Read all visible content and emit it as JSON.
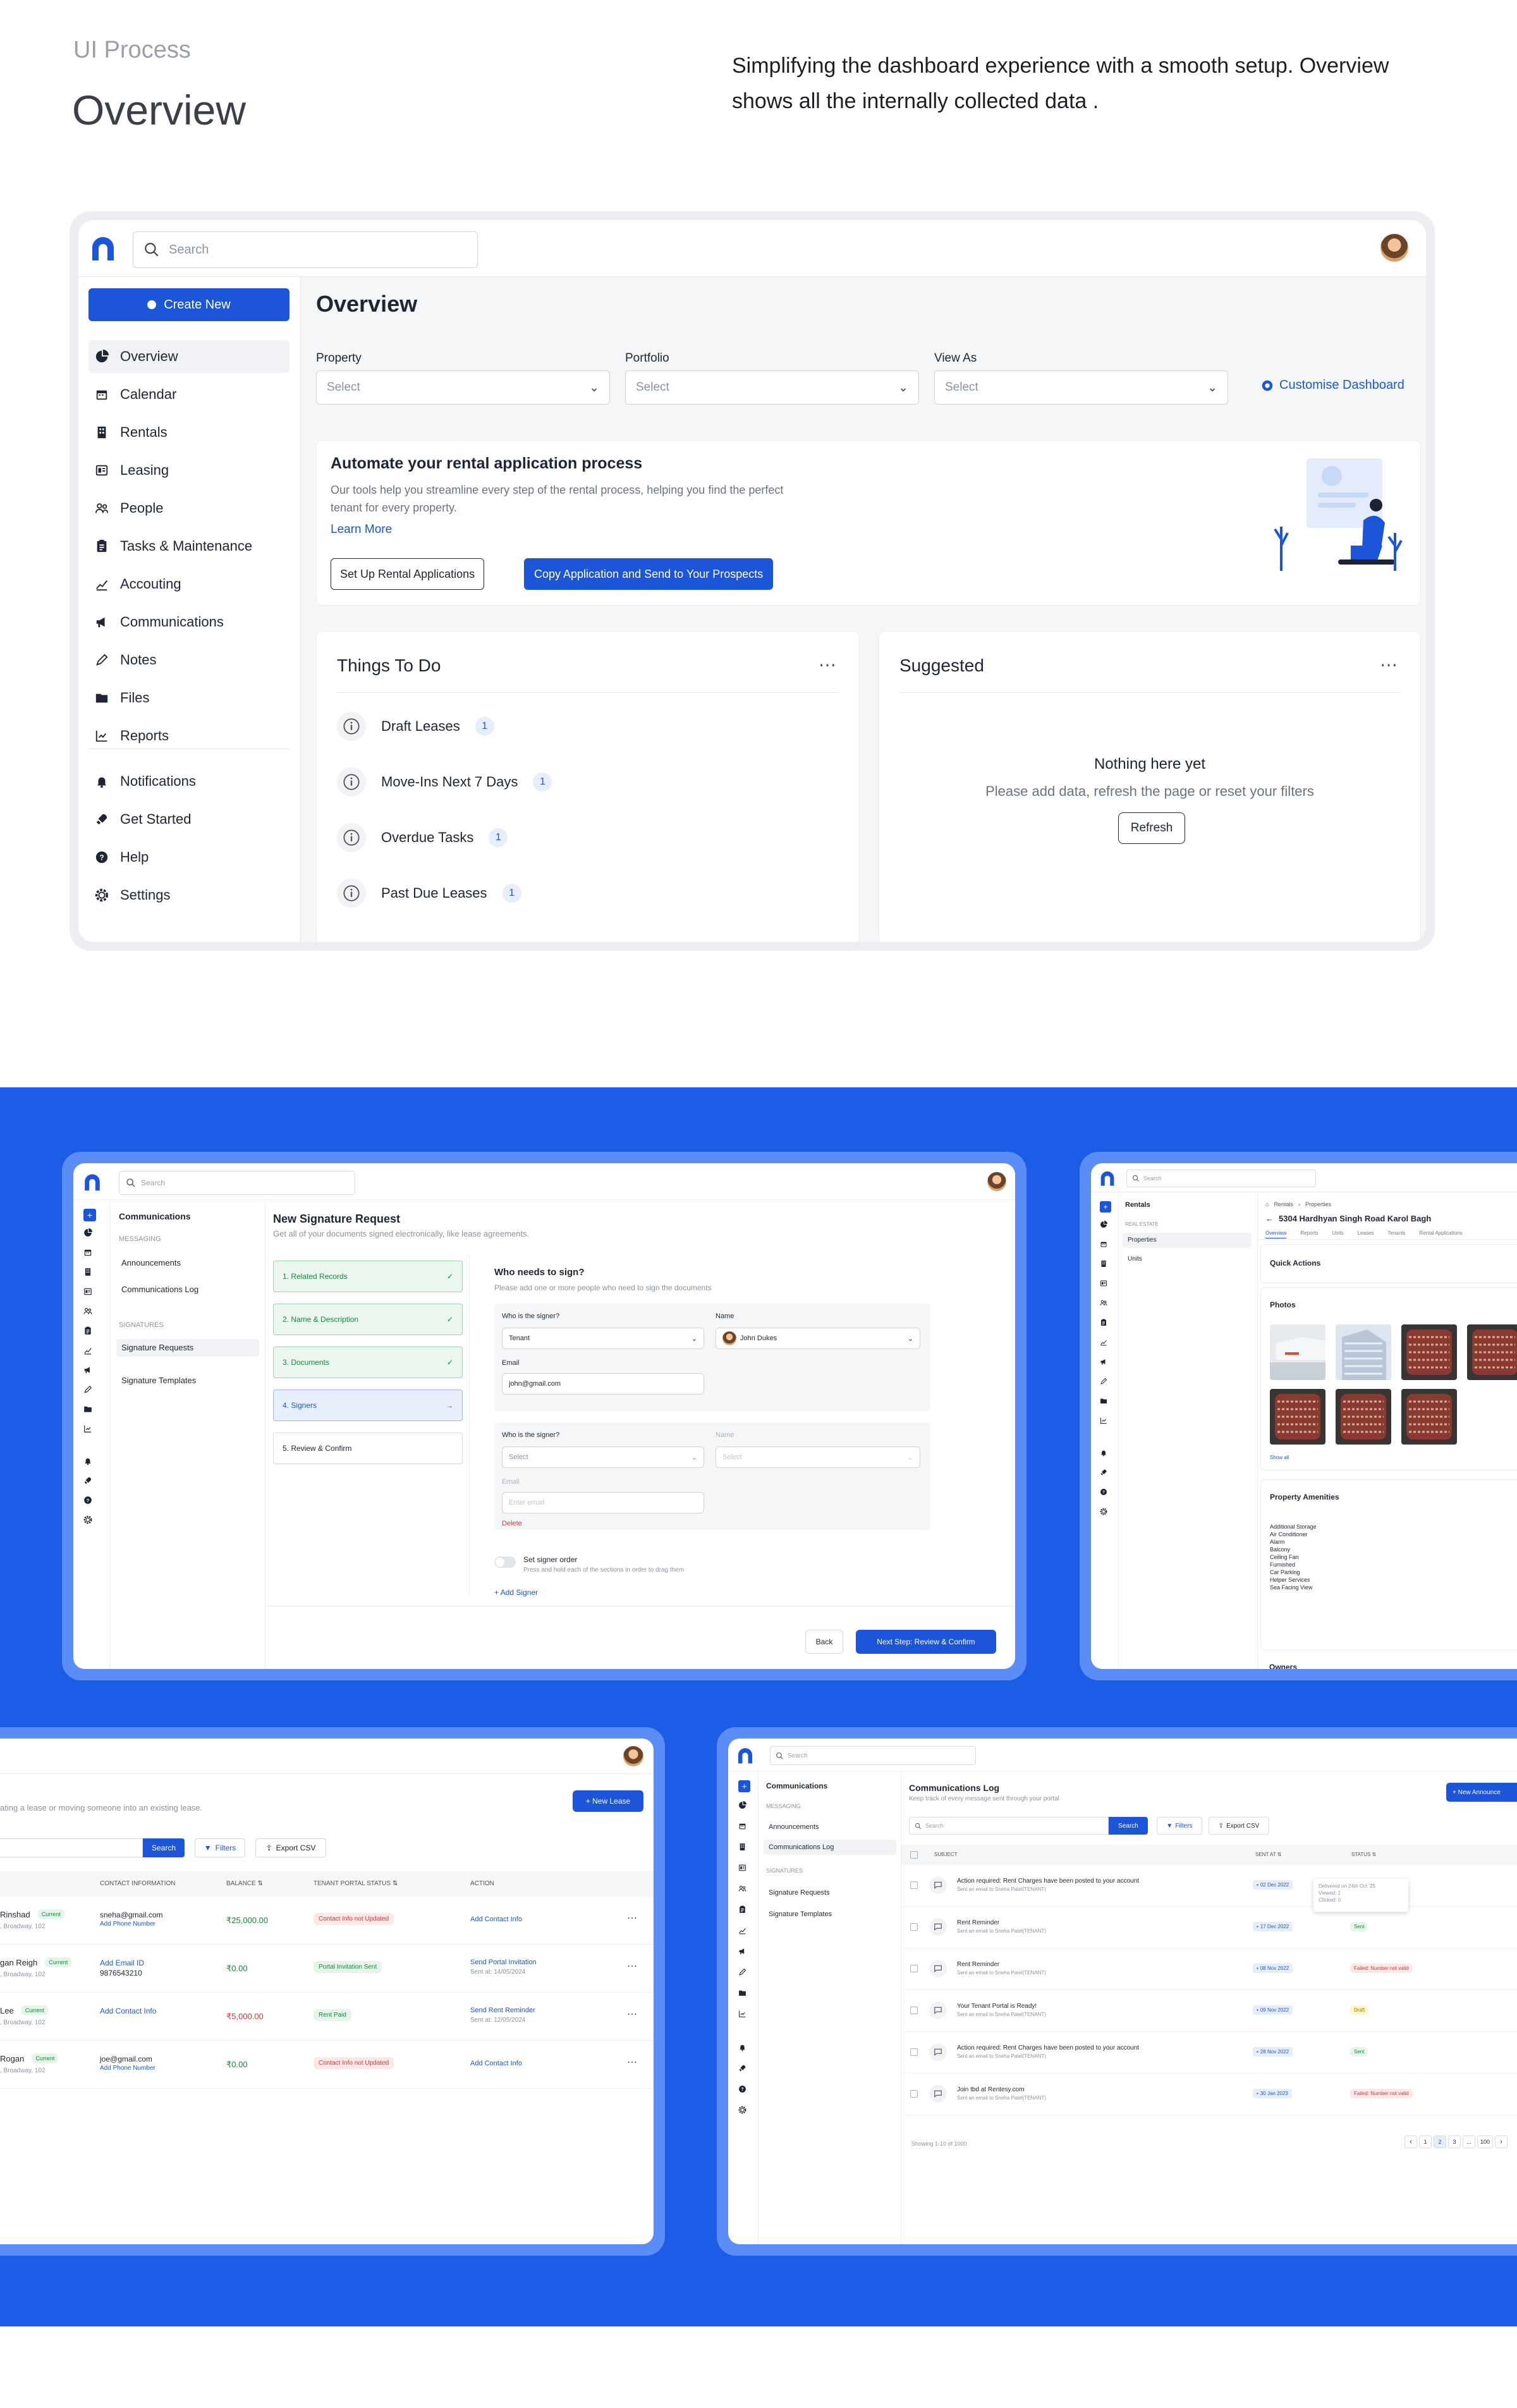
{
  "header": {
    "eyebrow": "UI Process",
    "title": "Overview",
    "description": "Simplifying the dashboard experience with a smooth setup. Overview shows all the internally collected data ."
  },
  "colors": {
    "brand": "#1c55d8",
    "bg_blue": "#1c5ce6",
    "light_blue": "#5b8df7",
    "green": "#148a3a",
    "red": "#d43838"
  },
  "main_mock": {
    "search_placeholder": "Search",
    "create_new": "Create New",
    "nav": [
      {
        "label": "Overview",
        "icon": "pie-chart-icon"
      },
      {
        "label": "Calendar",
        "icon": "calendar-icon"
      },
      {
        "label": "Rentals",
        "icon": "building-icon"
      },
      {
        "label": "Leasing",
        "icon": "lease-icon"
      },
      {
        "label": "People",
        "icon": "people-icon"
      },
      {
        "label": "Tasks & Maintenance",
        "icon": "clipboard-icon"
      },
      {
        "label": "Accouting",
        "icon": "chart-line-icon"
      },
      {
        "label": "Communications",
        "icon": "megaphone-icon"
      },
      {
        "label": "Notes",
        "icon": "pen-icon"
      },
      {
        "label": "Files",
        "icon": "folder-icon"
      },
      {
        "label": "Reports",
        "icon": "report-icon"
      }
    ],
    "nav_bottom": [
      {
        "label": "Notifications",
        "icon": "bell-icon"
      },
      {
        "label": "Get Started",
        "icon": "rocket-icon"
      },
      {
        "label": "Help",
        "icon": "help-icon"
      },
      {
        "label": "Settings",
        "icon": "gear-icon"
      }
    ],
    "page_title": "Overview",
    "filters": [
      {
        "label": "Property",
        "value": "Select"
      },
      {
        "label": "Portfolio",
        "value": "Select"
      },
      {
        "label": "View As",
        "value": "Select"
      }
    ],
    "customise": "Customise Dashboard",
    "banner": {
      "title": "Automate your rental application process",
      "text": "Our tools help you streamline every step of the rental process, helping you find the perfect tenant for every property.",
      "link": "Learn More",
      "btn1": "Set Up Rental Applications",
      "btn2": "Copy Application and Send to Your Prospects"
    },
    "todo": {
      "title": "Things To Do",
      "items": [
        {
          "label": "Draft Leases",
          "count": "1"
        },
        {
          "label": "Move-Ins Next 7 Days",
          "count": "1"
        },
        {
          "label": "Overdue Tasks",
          "count": "1"
        },
        {
          "label": "Past Due Leases",
          "count": "1"
        }
      ]
    },
    "suggested": {
      "title": "Suggested",
      "empty_title": "Nothing here yet",
      "empty_text": "Please add data, refresh the page or reset your filters",
      "refresh": "Refresh"
    }
  },
  "sig_mock": {
    "search": "Search",
    "section": "Communications",
    "messaging": "MESSAGING",
    "m_items": [
      "Announcements",
      "Communications Log"
    ],
    "signatures": "SIGNATURES",
    "s_items": [
      "Signature Requests",
      "Signature Templates"
    ],
    "title": "New Signature Request",
    "subtitle": "Get all of your documents signed electronically, like lease agreements.",
    "steps": [
      "1. Related Records",
      "2. Name & Description",
      "3. Documents",
      "4. Signers",
      "5. Review & Confirm"
    ],
    "who_title": "Who needs to sign?",
    "who_sub": "Please add one or more people who need to sign the documents",
    "signer_label": "Who is the signer?",
    "name_label": "Name",
    "email_label": "Email",
    "signer1": {
      "role": "Tenant",
      "name": "John Dukes",
      "email": "john@gmail.com"
    },
    "signer2": {
      "role": "Select",
      "name": "Select",
      "email": "Enter email"
    },
    "delete": "Delete",
    "order_title": "Set signer order",
    "order_sub": "Press and hold each of the sections in order to drag them",
    "add_signer": "+ Add Signer",
    "back": "Back",
    "next": "Next Step: Review & Confirm"
  },
  "prop_mock": {
    "search": "Search",
    "section": "Rentals",
    "real_estate": "REAL ESTATE",
    "items": [
      "Properties",
      "Units"
    ],
    "crumb1": "Rentals",
    "crumb2": "Properties",
    "title": "5304 Hardhyan Singh Road Karol Bagh",
    "tabs": [
      "Overview",
      "Reports",
      "Units",
      "Leases",
      "Tenants",
      "Rental Applications"
    ],
    "quick": "Quick Actions",
    "photos": "Photos",
    "show_all": "Show all",
    "amenities_title": "Property Amenities",
    "amenities": [
      "Additional Storage",
      "Air Conditioner",
      "Alarm",
      "Balcony",
      "Ceiling Fan",
      "Furnished",
      "Car Parking",
      "Helper Services",
      "Sea Facing View"
    ],
    "owners": "Owners"
  },
  "tenants_mock": {
    "subtitle": "ating a lease or moving someone into an existing lease.",
    "new_lease": "+ New Lease",
    "search_btn": "Search",
    "filters": "Filters",
    "export": "Export CSV",
    "cols": [
      "CONTACT INFORMATION",
      "BALANCE",
      "TENANT PORTAL STATUS",
      "ACTION"
    ],
    "rows": [
      {
        "name": "Rinshad",
        "badge": "Current",
        "addr": ", Broadway, 102",
        "c1": "sneha@gmail.com",
        "c2": "Add Phone Number",
        "bal": "₹25,000.00",
        "status": "Contact Info not Updated",
        "st": "red",
        "action": "Add Contact Info",
        "sent": ""
      },
      {
        "name": "gan Reigh",
        "badge": "Current",
        "addr": ", Broadway, 102",
        "c1": "Add Email ID",
        "c2": "9876543210",
        "bal": "₹0.00",
        "status": "Portal Invitation Sent",
        "st": "green",
        "action": "Send Portal Invitation",
        "sent": "Sent at: 14/05/2024"
      },
      {
        "name": "Lee",
        "badge": "Current",
        "addr": ", Broadway, 102",
        "c1": "Add Contact Info",
        "c2": "",
        "bal": "₹5,000.00",
        "status": "Rent Paid",
        "st": "green",
        "action": "Send Rent Reminder",
        "sent": "Sent at: 12/05/2024"
      },
      {
        "name": "Rogan",
        "badge": "Current",
        "addr": ", Broadway, 102",
        "c1": "joe@gmail.com",
        "c2": "Add Phone Number",
        "bal": "₹0.00",
        "status": "Contact Info not Updated",
        "st": "red",
        "action": "Add Contact Info",
        "sent": ""
      }
    ]
  },
  "log_mock": {
    "search": "Search",
    "section": "Communications",
    "messaging": "MESSAGING",
    "m_items": [
      "Announcements",
      "Communications Log"
    ],
    "signatures": "SIGNATURES",
    "s_items": [
      "Signature Requests",
      "Signature Templates"
    ],
    "title": "Communications Log",
    "subtitle": "Keep track of every message sent through your portal",
    "new_btn": "+ New Announce",
    "search_btn": "Search",
    "filters": "Filters",
    "export": "Export CSV",
    "cols": [
      "SUBJECT",
      "SENT AT",
      "STATUS"
    ],
    "rows": [
      {
        "subject": "Action required: Rent Charges have been posted to your account",
        "to": "Sent an email to Sneha Patel(TENANT)",
        "date": "02 Dec 2022",
        "status": "",
        "st": ""
      },
      {
        "subject": "Rent Reminder",
        "to": "Sent an email to Sneha Patel(TENANT)",
        "date": "17 Dec 2022",
        "status": "Sent",
        "st": "green"
      },
      {
        "subject": "Rent Reminder",
        "to": "Sent an email to Sneha Patel(TENANT)",
        "date": "08 Nov 2022",
        "status": "Failed: Number not valid",
        "st": "red"
      },
      {
        "subject": "Your Tenant Portal is Ready!",
        "to": "Sent an email to Sneha Patel(TENANT)",
        "date": "09 Nov 2022",
        "status": "Draft",
        "st": "yellow"
      },
      {
        "subject": "Action required: Rent Charges have been posted to your account",
        "to": "Sent an email to Sneha Patel(TENANT)",
        "date": "28 Nov 2022",
        "status": "Sent",
        "st": "green"
      },
      {
        "subject": "Join tbd at Rentesy.com",
        "to": "Sent an email to Sneha Patel(TENANT)",
        "date": "30 Jan 2023",
        "status": "Failed: Number not valid",
        "st": "red"
      }
    ],
    "tooltip": [
      "Delivered on 24th Oct '25",
      "Viewed: 1",
      "Clicked: 0"
    ],
    "showing": "Showing 1-10 of 1000",
    "pages": [
      "1",
      "2",
      "3",
      "...",
      "100"
    ]
  }
}
